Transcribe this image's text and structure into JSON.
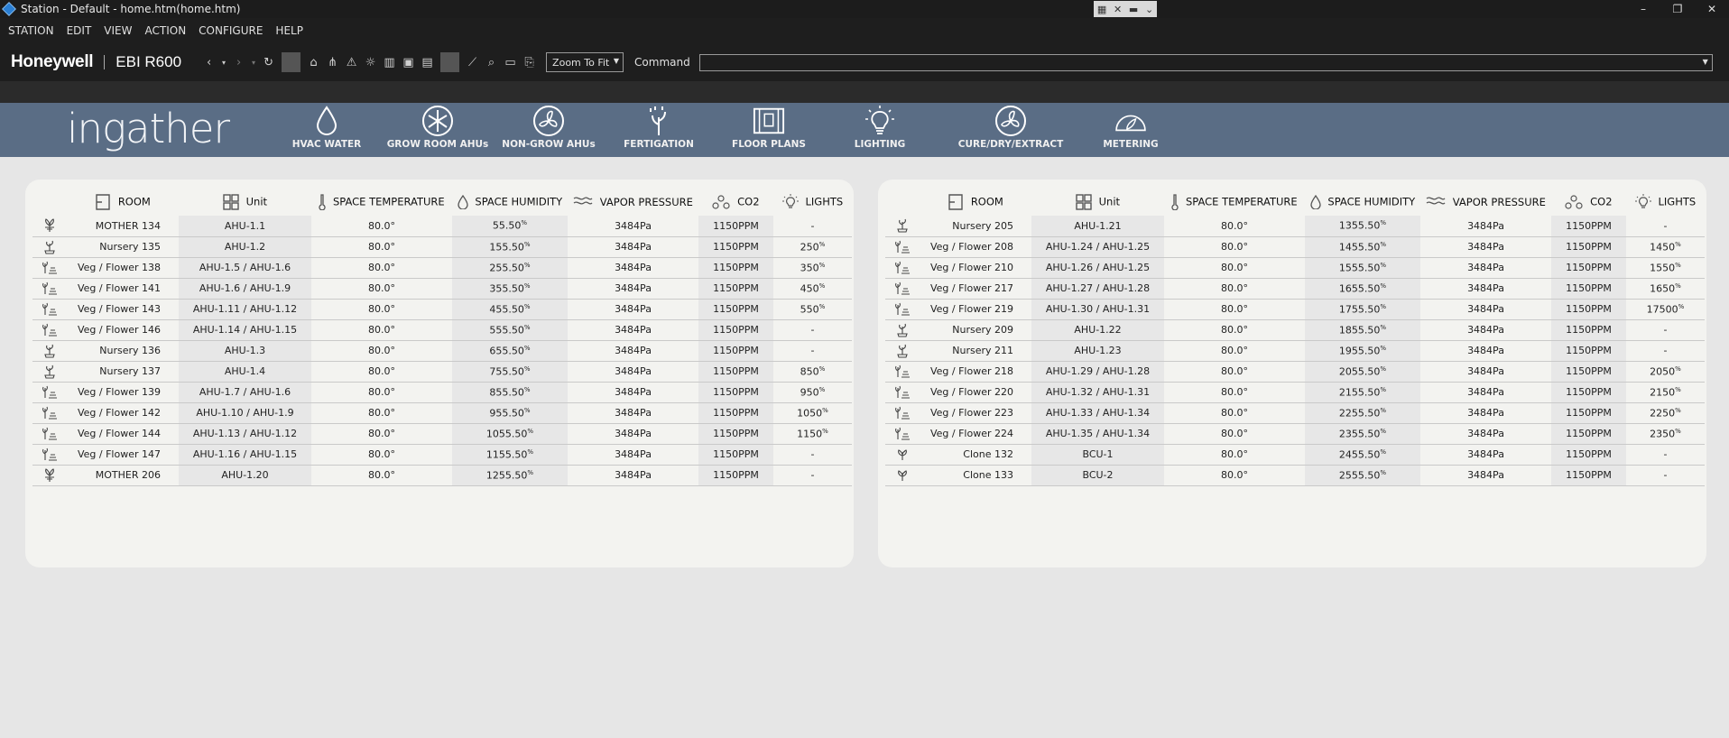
{
  "window": {
    "title": "Station - Default - home.htm(home.htm)"
  },
  "menu": [
    "STATION",
    "EDIT",
    "VIEW",
    "ACTION",
    "CONFIGURE",
    "HELP"
  ],
  "toolbar": {
    "brand": "Honeywell",
    "product": "EBI R600",
    "zoom": "Zoom To Fit",
    "command_label": "Command",
    "command_value": ""
  },
  "nav": {
    "logo": "ingather",
    "items": [
      {
        "label": "HVAC WATER",
        "icon": "water-drop-icon"
      },
      {
        "label": "GROW ROOM AHUs",
        "icon": "fan-leaf-icon"
      },
      {
        "label": "NON-GROW AHUs",
        "icon": "fan-icon"
      },
      {
        "label": "FERTIGATION",
        "icon": "plant-icon"
      },
      {
        "label": "FLOOR PLANS",
        "icon": "floor-plan-icon"
      },
      {
        "label": "LIGHTING",
        "icon": "light-bulb-icon"
      },
      {
        "label": "CURE/DRY/EXTRACT",
        "icon": "fan-icon"
      },
      {
        "label": "METERING",
        "icon": "gauge-icon"
      }
    ]
  },
  "headers": {
    "room": "ROOM",
    "unit": "Unit",
    "temp": "SPACE TEMPERATURE",
    "humidity": "SPACE HUMIDITY",
    "vapor": "VAPOR PRESSURE",
    "co2": "CO2",
    "lights": "LIGHTS"
  },
  "left_rows": [
    {
      "icon": "mother",
      "room": "MOTHER 134",
      "unit": "AHU-1.1",
      "temp": "80.0°",
      "hum": "55.50",
      "vp": "3484Pa",
      "co2": "1150PPM",
      "lights": "-"
    },
    {
      "icon": "nursery",
      "room": "Nursery 135",
      "unit": "AHU-1.2",
      "temp": "80.0°",
      "hum": "155.50",
      "vp": "3484Pa",
      "co2": "1150PPM",
      "lights": "250"
    },
    {
      "icon": "veg",
      "room": "Veg / Flower 138",
      "unit": "AHU-1.5 / AHU-1.6",
      "temp": "80.0°",
      "hum": "255.50",
      "vp": "3484Pa",
      "co2": "1150PPM",
      "lights": "350"
    },
    {
      "icon": "veg",
      "room": "Veg / Flower 141",
      "unit": "AHU-1.6 / AHU-1.9",
      "temp": "80.0°",
      "hum": "355.50",
      "vp": "3484Pa",
      "co2": "1150PPM",
      "lights": "450"
    },
    {
      "icon": "veg",
      "room": "Veg / Flower 143",
      "unit": "AHU-1.11 / AHU-1.12",
      "temp": "80.0°",
      "hum": "455.50",
      "vp": "3484Pa",
      "co2": "1150PPM",
      "lights": "550"
    },
    {
      "icon": "veg",
      "room": "Veg / Flower 146",
      "unit": "AHU-1.14 / AHU-1.15",
      "temp": "80.0°",
      "hum": "555.50",
      "vp": "3484Pa",
      "co2": "1150PPM",
      "lights": "-"
    },
    {
      "icon": "nursery",
      "room": "Nursery 136",
      "unit": "AHU-1.3",
      "temp": "80.0°",
      "hum": "655.50",
      "vp": "3484Pa",
      "co2": "1150PPM",
      "lights": "-"
    },
    {
      "icon": "nursery",
      "room": "Nursery 137",
      "unit": "AHU-1.4",
      "temp": "80.0°",
      "hum": "755.50",
      "vp": "3484Pa",
      "co2": "1150PPM",
      "lights": "850"
    },
    {
      "icon": "veg",
      "room": "Veg / Flower 139",
      "unit": "AHU-1.7 / AHU-1.6",
      "temp": "80.0°",
      "hum": "855.50",
      "vp": "3484Pa",
      "co2": "1150PPM",
      "lights": "950"
    },
    {
      "icon": "veg",
      "room": "Veg / Flower 142",
      "unit": "AHU-1.10 / AHU-1.9",
      "temp": "80.0°",
      "hum": "955.50",
      "vp": "3484Pa",
      "co2": "1150PPM",
      "lights": "1050"
    },
    {
      "icon": "veg",
      "room": "Veg / Flower 144",
      "unit": "AHU-1.13 / AHU-1.12",
      "temp": "80.0°",
      "hum": "1055.50",
      "vp": "3484Pa",
      "co2": "1150PPM",
      "lights": "1150"
    },
    {
      "icon": "veg",
      "room": "Veg / Flower 147",
      "unit": "AHU-1.16 / AHU-1.15",
      "temp": "80.0°",
      "hum": "1155.50",
      "vp": "3484Pa",
      "co2": "1150PPM",
      "lights": "-"
    },
    {
      "icon": "mother",
      "room": "MOTHER 206",
      "unit": "AHU-1.20",
      "temp": "80.0°",
      "hum": "1255.50",
      "vp": "3484Pa",
      "co2": "1150PPM",
      "lights": "-"
    }
  ],
  "right_rows": [
    {
      "icon": "nursery",
      "room": "Nursery 205",
      "unit": "AHU-1.21",
      "temp": "80.0°",
      "hum": "1355.50",
      "vp": "3484Pa",
      "co2": "1150PPM",
      "lights": "-"
    },
    {
      "icon": "veg",
      "room": "Veg / Flower 208",
      "unit": "AHU-1.24 / AHU-1.25",
      "temp": "80.0°",
      "hum": "1455.50",
      "vp": "3484Pa",
      "co2": "1150PPM",
      "lights": "1450"
    },
    {
      "icon": "veg",
      "room": "Veg / Flower 210",
      "unit": "AHU-1.26 / AHU-1.25",
      "temp": "80.0°",
      "hum": "1555.50",
      "vp": "3484Pa",
      "co2": "1150PPM",
      "lights": "1550"
    },
    {
      "icon": "veg",
      "room": "Veg / Flower 217",
      "unit": "AHU-1.27 / AHU-1.28",
      "temp": "80.0°",
      "hum": "1655.50",
      "vp": "3484Pa",
      "co2": "1150PPM",
      "lights": "1650"
    },
    {
      "icon": "veg",
      "room": "Veg / Flower 219",
      "unit": "AHU-1.30 / AHU-1.31",
      "temp": "80.0°",
      "hum": "1755.50",
      "vp": "3484Pa",
      "co2": "1150PPM",
      "lights": "17500"
    },
    {
      "icon": "nursery",
      "room": "Nursery 209",
      "unit": "AHU-1.22",
      "temp": "80.0°",
      "hum": "1855.50",
      "vp": "3484Pa",
      "co2": "1150PPM",
      "lights": "-"
    },
    {
      "icon": "nursery",
      "room": "Nursery 211",
      "unit": "AHU-1.23",
      "temp": "80.0°",
      "hum": "1955.50",
      "vp": "3484Pa",
      "co2": "1150PPM",
      "lights": "-"
    },
    {
      "icon": "veg",
      "room": "Veg / Flower 218",
      "unit": "AHU-1.29 / AHU-1.28",
      "temp": "80.0°",
      "hum": "2055.50",
      "vp": "3484Pa",
      "co2": "1150PPM",
      "lights": "2050"
    },
    {
      "icon": "veg",
      "room": "Veg / Flower 220",
      "unit": "AHU-1.32 / AHU-1.31",
      "temp": "80.0°",
      "hum": "2155.50",
      "vp": "3484Pa",
      "co2": "1150PPM",
      "lights": "2150"
    },
    {
      "icon": "veg",
      "room": "Veg / Flower 223",
      "unit": "AHU-1.33 / AHU-1.34",
      "temp": "80.0°",
      "hum": "2255.50",
      "vp": "3484Pa",
      "co2": "1150PPM",
      "lights": "2250"
    },
    {
      "icon": "veg",
      "room": "Veg / Flower 224",
      "unit": "AHU-1.35 / AHU-1.34",
      "temp": "80.0°",
      "hum": "2355.50",
      "vp": "3484Pa",
      "co2": "1150PPM",
      "lights": "2350"
    },
    {
      "icon": "clone",
      "room": "Clone 132",
      "unit": "BCU-1",
      "temp": "80.0°",
      "hum": "2455.50",
      "vp": "3484Pa",
      "co2": "1150PPM",
      "lights": "-"
    },
    {
      "icon": "clone",
      "room": "Clone 133",
      "unit": "BCU-2",
      "temp": "80.0°",
      "hum": "2555.50",
      "vp": "3484Pa",
      "co2": "1150PPM",
      "lights": "-"
    }
  ],
  "colors": {
    "band": "#5a6d85",
    "panel": "#f3f3f0",
    "chrome": "#1e1e1e"
  }
}
